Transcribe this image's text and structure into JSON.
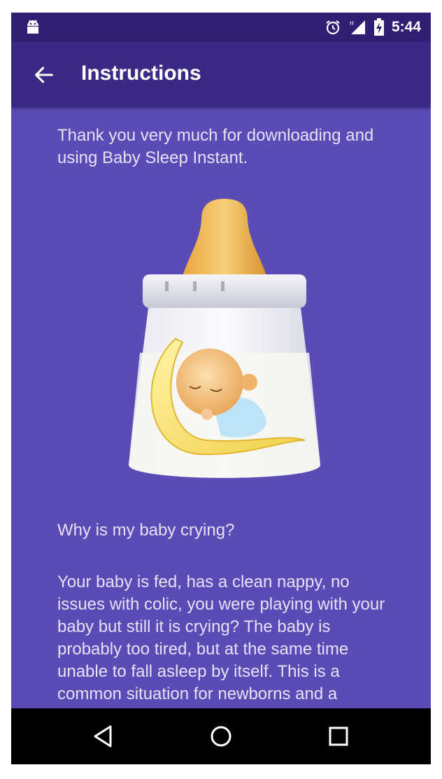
{
  "status_bar": {
    "time": "5:44",
    "icons": [
      "android-icon",
      "alarm-icon",
      "signal-icon",
      "battery-charging-icon"
    ]
  },
  "app_bar": {
    "title": "Instructions",
    "back_icon": "arrow-left-icon"
  },
  "content": {
    "intro": "Thank you very much for downloading and using Baby Sleep Instant.",
    "image_icon": "baby-bottle-sleeping-baby-illustration",
    "question": "Why is my baby crying?",
    "paragraph": "Your baby is fed, has a clean nappy, no issues with colic, you were playing with your baby but still it is crying? The baby is probably too tired, but at the same time unable to fall asleep by itself. This is a common situation for newborns and a situation where Baby Sleep Instant"
  },
  "nav_bar": {
    "icons": [
      "back-triangle-icon",
      "home-circle-icon",
      "recents-square-icon"
    ]
  },
  "colors": {
    "background": "#5b4bb5",
    "app_bar": "#3a2a86",
    "status_bar": "#2e1f73"
  }
}
